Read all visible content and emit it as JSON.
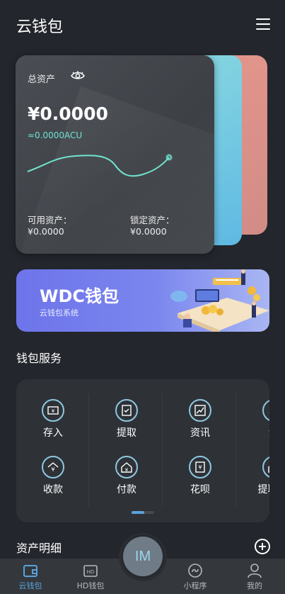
{
  "header": {
    "title": "云钱包"
  },
  "asset_card": {
    "total_label": "总资产",
    "total_value": "¥0.0000",
    "acu_value": "≈0.0000ACU",
    "available_label": "可用资产：",
    "available_value": "¥0.0000",
    "locked_label": "锁定资产：",
    "locked_value": "¥0.0000"
  },
  "banner": {
    "title": "WDC钱包",
    "subtitle": "云钱包系统"
  },
  "services": {
    "title": "钱包服务",
    "items": [
      {
        "label": "存入",
        "icon": "deposit-icon"
      },
      {
        "label": "提取",
        "icon": "withdraw-icon"
      },
      {
        "label": "资讯",
        "icon": "news-icon"
      },
      {
        "label": "划",
        "icon": "transfer-icon"
      },
      {
        "label": "收款",
        "icon": "receive-icon"
      },
      {
        "label": "付款",
        "icon": "pay-icon"
      },
      {
        "label": "花呗",
        "icon": "credit-icon"
      },
      {
        "label": "提取TA",
        "icon": "withdraw-ta-icon"
      }
    ]
  },
  "details": {
    "title": "资产明细"
  },
  "nav": {
    "items": [
      {
        "label": "云钱包",
        "icon": "wallet-icon",
        "active": true
      },
      {
        "label": "HD钱包",
        "icon": "hd-wallet-icon",
        "active": false
      },
      {
        "label": "小程序",
        "icon": "mini-program-icon",
        "active": false
      },
      {
        "label": "我的",
        "icon": "profile-icon",
        "active": false
      }
    ],
    "center_label": "IM"
  },
  "colors": {
    "background": "#23262c",
    "accent": "#5aa2d9",
    "teal": "#6fe3cf",
    "banner_start": "#6d74ea"
  }
}
